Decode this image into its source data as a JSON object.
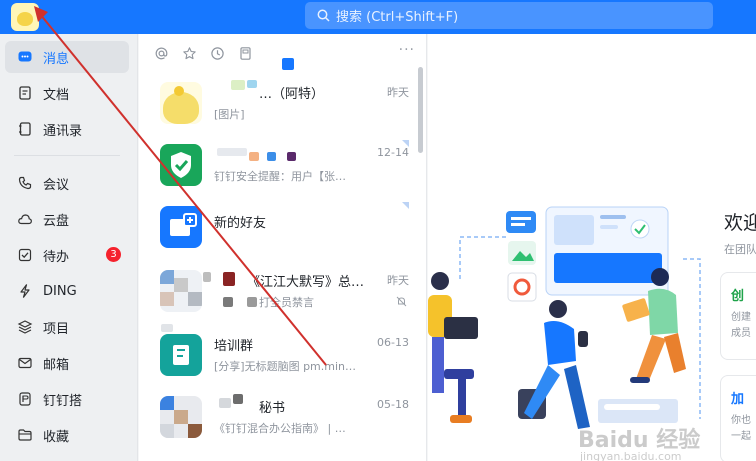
{
  "search": {
    "placeholder": "搜索 (Ctrl+Shift+F)"
  },
  "nav": {
    "items": [
      {
        "label": "消息",
        "icon": "message-icon"
      },
      {
        "label": "文档",
        "icon": "document-icon"
      },
      {
        "label": "通讯录",
        "icon": "contacts-icon"
      },
      {
        "label": "会议",
        "icon": "phone-icon"
      },
      {
        "label": "云盘",
        "icon": "cloud-icon"
      },
      {
        "label": "待办",
        "icon": "todo-icon",
        "badge": "3"
      },
      {
        "label": "DING",
        "icon": "lightning-icon"
      },
      {
        "label": "项目",
        "icon": "project-icon"
      },
      {
        "label": "邮箱",
        "icon": "mail-icon"
      },
      {
        "label": "钉钉搭",
        "icon": "builder-icon"
      },
      {
        "label": "收藏",
        "icon": "folder-icon"
      }
    ]
  },
  "conversations": [
    {
      "title": "…（阿特）",
      "sub": "[图片]",
      "time": "昨天"
    },
    {
      "title": "",
      "sub": "钉钉安全提醒：用户【张…",
      "time": "12-14"
    },
    {
      "title": "新的好友",
      "sub": "",
      "time": ""
    },
    {
      "title": "《江江大默写》总…",
      "sub": "打全员禁言",
      "time": "昨天"
    },
    {
      "title": "培训群",
      "sub": "[分享]无标题脑图 pm.min…",
      "time": "06-13"
    },
    {
      "title": "秘书",
      "sub": "《钉钉混合办公指南》 | …",
      "time": "05-18"
    }
  ],
  "welcome": {
    "title": "欢迎",
    "subtitle": "在团队",
    "cards": [
      {
        "title": "创",
        "lines": [
          "创建",
          "成员"
        ]
      },
      {
        "title": "加",
        "lines": [
          "你也",
          "一起"
        ]
      }
    ]
  },
  "watermark": {
    "brand": "Baidu 经验",
    "url": "jingyan.baidu.com"
  },
  "colors": {
    "accent": "#1677ff",
    "badge": "#f5222d",
    "arrow": "#d0312d"
  }
}
